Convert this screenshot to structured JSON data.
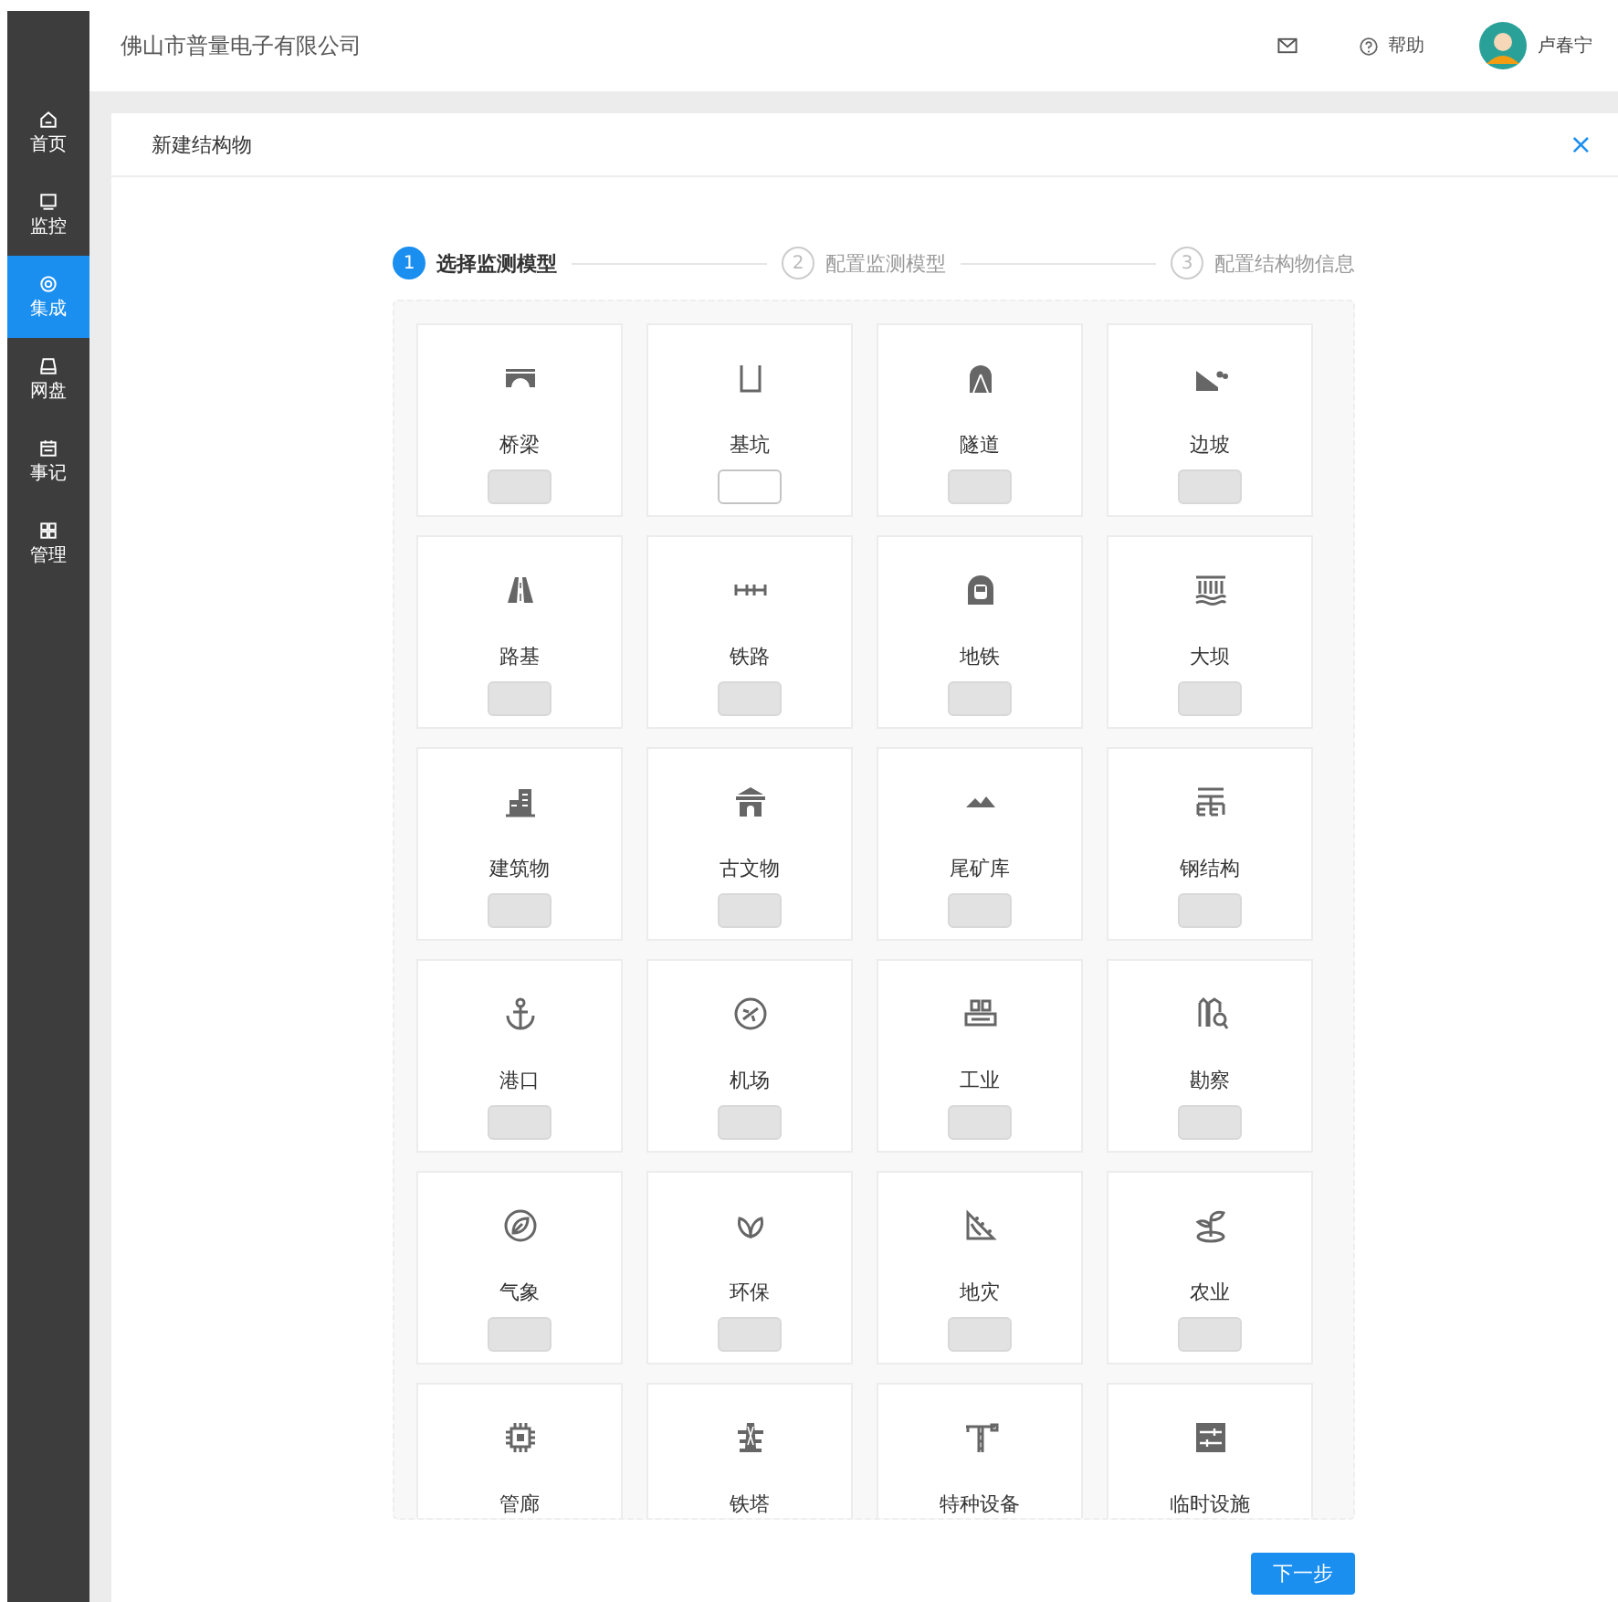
{
  "sidebar": {
    "items": [
      {
        "label": "首页",
        "selected": false
      },
      {
        "label": "监控",
        "selected": false
      },
      {
        "label": "集成",
        "selected": true
      },
      {
        "label": "网盘",
        "selected": false
      },
      {
        "label": "事记",
        "selected": false
      },
      {
        "label": "管理",
        "selected": false
      }
    ]
  },
  "header": {
    "company": "佛山市普量电子有限公司",
    "help": "帮助",
    "user": "卢春宁"
  },
  "panel": {
    "title": "新建结构物",
    "close": "×"
  },
  "steps": [
    {
      "number": "1",
      "label": "选择监测模型",
      "selected": true
    },
    {
      "number": "2",
      "label": "配置监测模型",
      "selected": false
    },
    {
      "number": "3",
      "label": "配置结构物信息",
      "selected": false
    }
  ],
  "structures": [
    {
      "label": "桥梁",
      "disabled": true
    },
    {
      "label": "基坑",
      "disabled": false
    },
    {
      "label": "隧道",
      "disabled": true
    },
    {
      "label": "边坡",
      "disabled": true
    },
    {
      "label": "路基",
      "disabled": true
    },
    {
      "label": "铁路",
      "disabled": true
    },
    {
      "label": "地铁",
      "disabled": true
    },
    {
      "label": "大坝",
      "disabled": true
    },
    {
      "label": "建筑物",
      "disabled": true
    },
    {
      "label": "古文物",
      "disabled": true
    },
    {
      "label": "尾矿库",
      "disabled": true
    },
    {
      "label": "钢结构",
      "disabled": true
    },
    {
      "label": "港口",
      "disabled": true
    },
    {
      "label": "机场",
      "disabled": true
    },
    {
      "label": "工业",
      "disabled": true
    },
    {
      "label": "勘察",
      "disabled": true
    },
    {
      "label": "气象",
      "disabled": true
    },
    {
      "label": "环保",
      "disabled": true
    },
    {
      "label": "地灾",
      "disabled": true
    },
    {
      "label": "农业",
      "disabled": true
    },
    {
      "label": "管廊"
    },
    {
      "label": "铁塔"
    },
    {
      "label": "特种设备"
    },
    {
      "label": "临时设施"
    }
  ],
  "next_button": "下一步"
}
